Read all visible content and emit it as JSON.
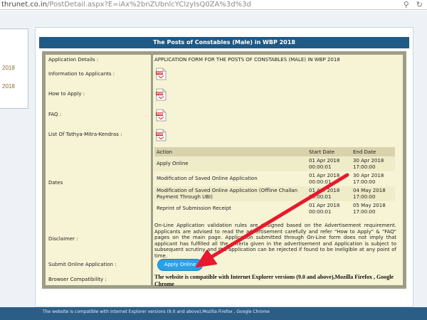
{
  "browser": {
    "url_host": "thrunet.co.in",
    "url_path": "/PostDetail.aspx?E=iAx%2bnZUbnlcYClzyIsQ0ZA%3d%3d",
    "search_glyph": "⚲",
    "reload_glyph": "↻"
  },
  "left_panel": {
    "text": "2018"
  },
  "post": {
    "title": "The Posts of Constables (Male) in WBP 2018",
    "labels": {
      "application_details": "Application Details :",
      "information": "Information to Applicants :",
      "how_to_apply": "How to Apply :",
      "faq": "FAQ :",
      "tathya": "List Of Tathya-Mitra-Kendras :",
      "dates": "Dates",
      "disclaimer": "Disclaimer :",
      "submit": "Submit Online Application :",
      "browser": "Browser Compatibility :"
    },
    "application_details_value": "APPLICATION FORM FOR THE POSTS OF CONSTABLES (MALE) IN WBP 2018",
    "pdf_icon_text": "PDF",
    "dates_table": {
      "headers": [
        "Action",
        "Start Date",
        "End Date"
      ],
      "rows": [
        {
          "action": "Apply Online",
          "start_date": "01 Apr 2018",
          "start_time": "00:00:01",
          "end_date": "30 Apr 2018",
          "end_time": "17:00:00"
        },
        {
          "action": "Modification of Saved Online Application",
          "start_date": "01 Apr 2018",
          "start_time": "00:00:01",
          "end_date": "30 Apr 2018",
          "end_time": "17:00:00"
        },
        {
          "action": "Modification of Saved Online Application (Offline Challan Payment Through UBI)",
          "start_date": "01 Apr 2018",
          "start_time": "00:00:01",
          "end_date": "04 May 2018",
          "end_time": "17:00:00"
        },
        {
          "action": "Reprint of Submission Receipt",
          "start_date": "01 Apr 2018",
          "start_time": "00:00:01",
          "end_date": "05 May 2018",
          "end_time": "17:00:00"
        }
      ]
    },
    "disclaimer_text": "On-Line Application validation rules are designed based on the Advertisement requirement. Applicants are advised to read the advertisement carefully and refer \"How to Apply\" & \"FAQ\" pages on the main page. Application submitted through On-Line form does not imply that applicant has fulfilled all the criteria given in the advertisement and Application is subject to subsequent scrutiny and the application can be rejected if found to be ineligible at any point of time.",
    "apply_button_label": "Apply Online",
    "compatibility_text": "The website is compatible with Internet Explorer versions (9.0 and above),Mozilla Firefox , Google Chrome"
  },
  "footer": {
    "text": "The website is compatible with Internet Explorer versions (9.0 and above),Mozilla Firefox , Google Chrome"
  },
  "colors": {
    "title_bar": "#1f5a86",
    "panel_bg": "#f7f4d6",
    "panel_border": "#9d9e86",
    "button": "#2aa0e6",
    "arrow": "#e8192c",
    "footer": "#2b5d86"
  }
}
